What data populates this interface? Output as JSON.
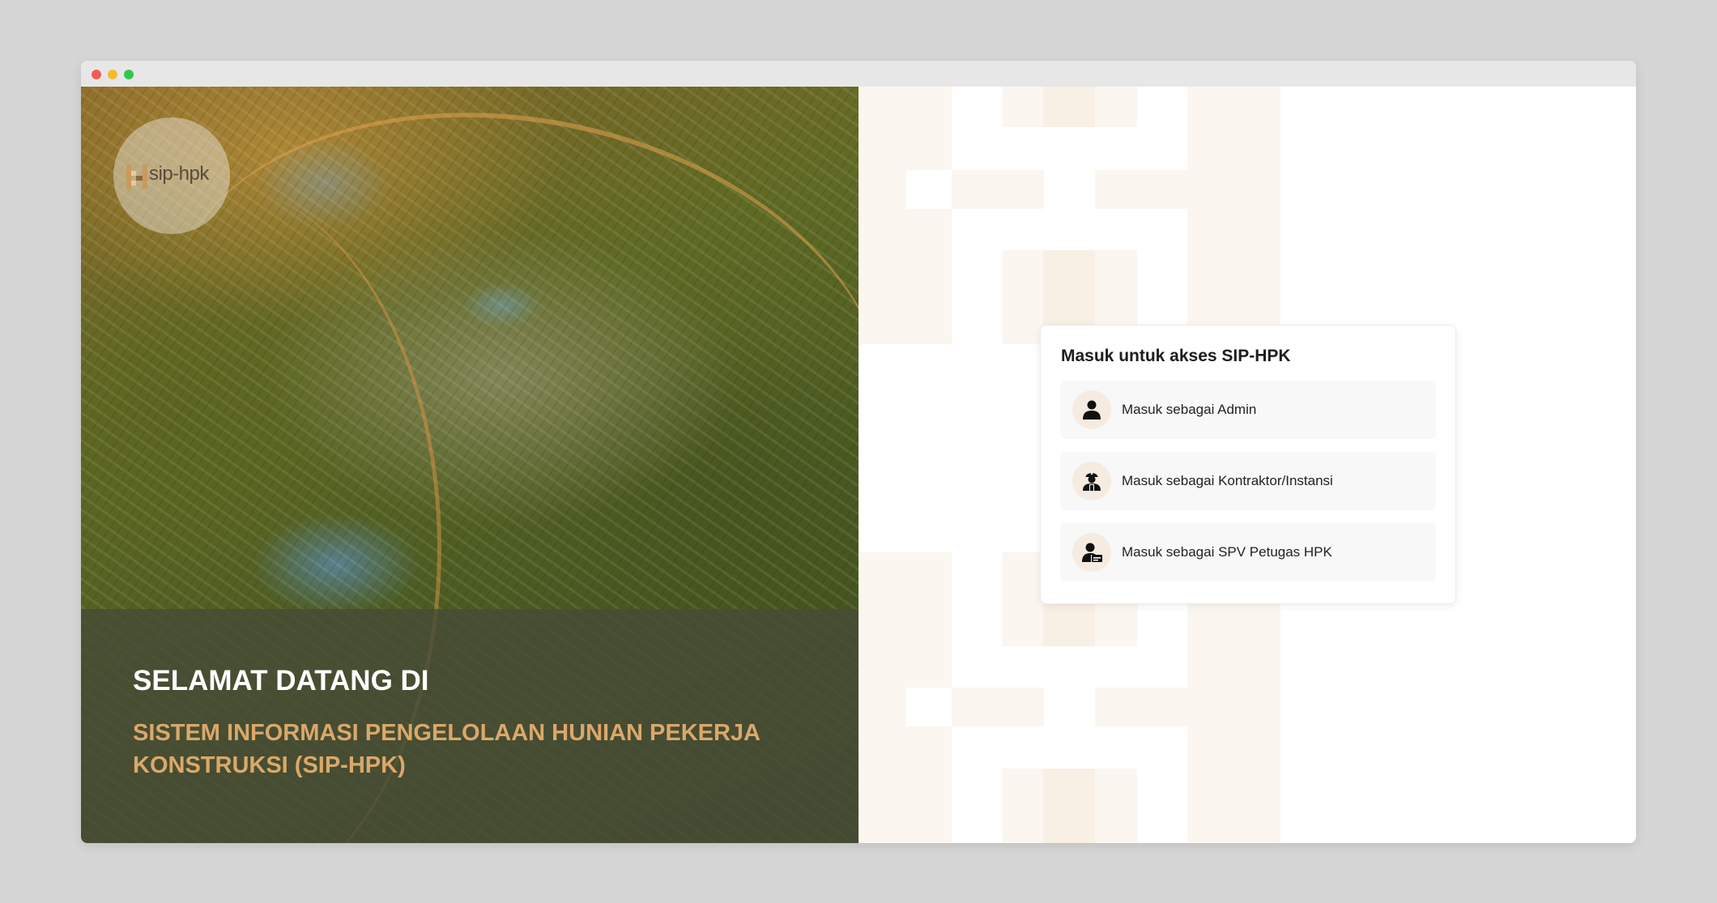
{
  "window": {
    "controls": [
      "close-dot",
      "minimize-dot",
      "maximize-dot"
    ]
  },
  "brand": {
    "logo_text": "sip-hpk",
    "logo_icon": "sip-hpk-logo-mark"
  },
  "hero": {
    "welcome": "SELAMAT DATANG DI",
    "subtitle": "SISTEM INFORMASI PENGELOLAAN HUNIAN PEKERJA KONSTRUKSI (SIP-HPK)"
  },
  "login": {
    "title": "Masuk untuk akses SIP-HPK",
    "options": [
      {
        "label": "Masuk sebagai Admin",
        "icon": "admin-user-icon"
      },
      {
        "label": "Masuk sebagai Kontraktor/Instansi",
        "icon": "contractor-worker-icon"
      },
      {
        "label": "Masuk sebagai SPV Petugas HPK",
        "icon": "supervisor-user-icon"
      }
    ]
  },
  "colors": {
    "accent": "#dba869",
    "icon_bg": "#f6ebe0",
    "pattern": "#fbf6f0"
  }
}
